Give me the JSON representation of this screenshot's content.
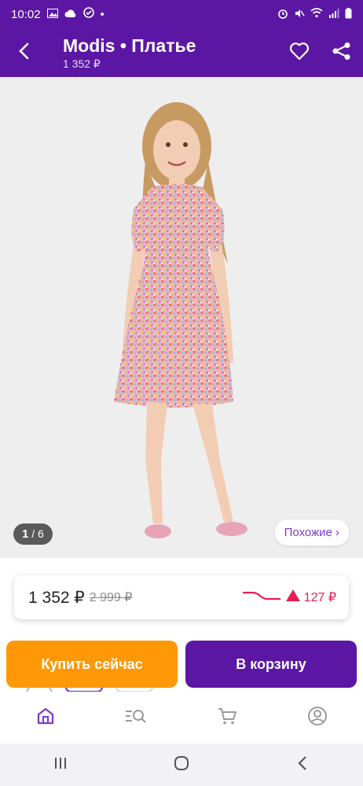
{
  "status_bar": {
    "time": "10:02",
    "dot": "•"
  },
  "header": {
    "title": "Modis • Платье",
    "subtitle": "1 352 ₽",
    "icons": [
      "back-arrow-icon",
      "heart-icon",
      "share-icon"
    ]
  },
  "gallery": {
    "counter_current": "1",
    "counter_sep": " / ",
    "counter_total": "6",
    "similar_label": "Похожие ›"
  },
  "price": {
    "current": "1 352 ₽",
    "old": "2 999 ₽",
    "trend_value": "127 ₽",
    "trend_color": "#e91e53"
  },
  "actions": {
    "buy_now": "Купить сейчас",
    "add_to_cart": "В корзину"
  },
  "bottom_nav": {
    "items": [
      "home-icon",
      "catalog-search-icon",
      "cart-icon",
      "profile-icon"
    ],
    "active_color": "#7b3bc8"
  },
  "colors": {
    "brand_purple": "#5b17a3",
    "buy_orange": "#ff9806"
  }
}
